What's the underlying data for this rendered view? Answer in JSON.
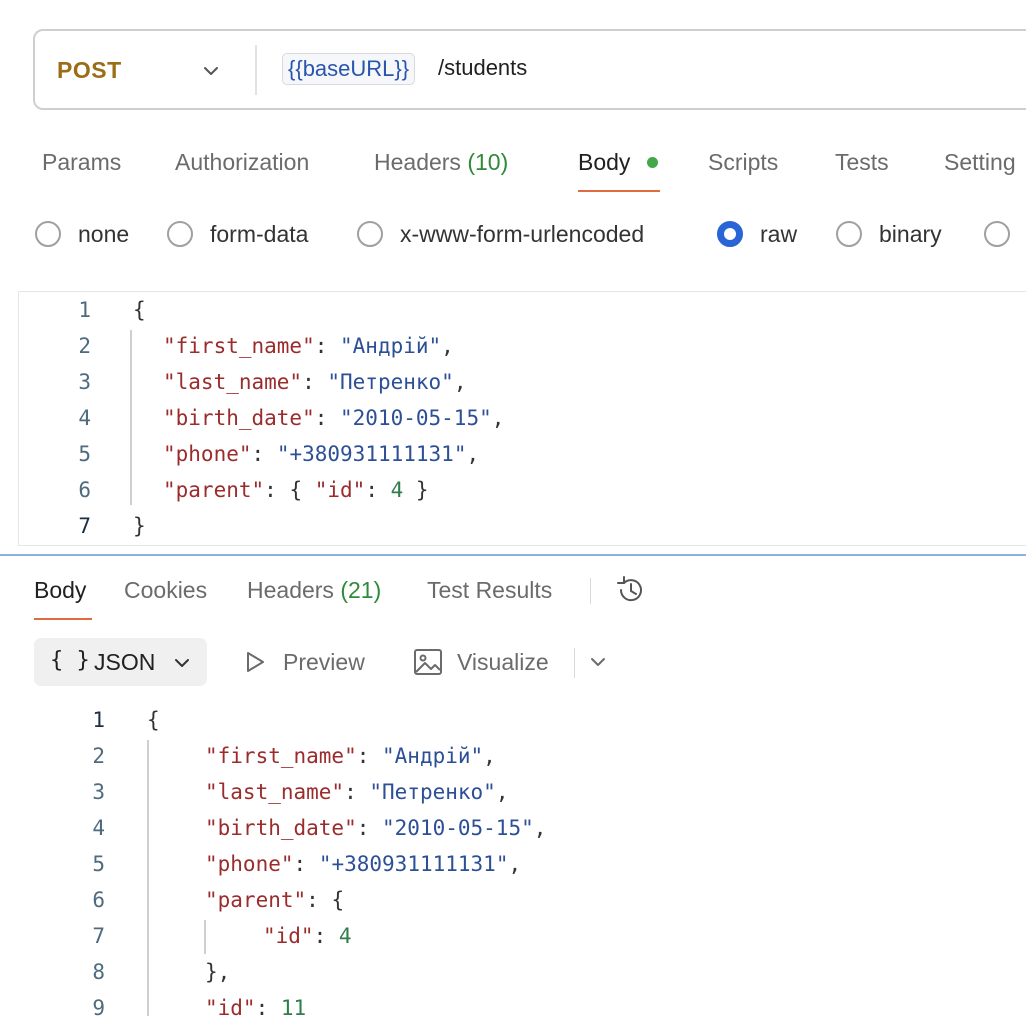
{
  "request": {
    "method": "POST",
    "url_variable": "{{baseURL}}",
    "url_path": "/students"
  },
  "request_tabs": [
    {
      "label": "Params"
    },
    {
      "label": "Authorization"
    },
    {
      "label": "Headers",
      "count": "(10)"
    },
    {
      "label": "Body",
      "active": true
    },
    {
      "label": "Scripts"
    },
    {
      "label": "Tests"
    },
    {
      "label": "Setting"
    }
  ],
  "body_types": [
    {
      "label": "none",
      "selected": false
    },
    {
      "label": "form-data",
      "selected": false
    },
    {
      "label": "x-www-form-urlencoded",
      "selected": false
    },
    {
      "label": "raw",
      "selected": true
    },
    {
      "label": "binary",
      "selected": false
    }
  ],
  "request_body": {
    "line_numbers": [
      "1",
      "2",
      "3",
      "4",
      "5",
      "6",
      "7"
    ],
    "keys": {
      "first_name": "\"first_name\"",
      "last_name": "\"last_name\"",
      "birth_date": "\"birth_date\"",
      "phone": "\"phone\"",
      "parent": "\"parent\"",
      "id": "\"id\""
    },
    "values": {
      "first_name": "\"Андрій\"",
      "last_name": "\"Петренко\"",
      "birth_date": "\"2010-05-15\"",
      "phone": "\"+380931111131\"",
      "parent_id": "4"
    }
  },
  "response_tabs": [
    {
      "label": "Body",
      "active": true
    },
    {
      "label": "Cookies"
    },
    {
      "label": "Headers",
      "count": "(21)"
    },
    {
      "label": "Test Results"
    }
  ],
  "response_toolbar": {
    "format_icon": "{ }",
    "format": "JSON",
    "preview": "Preview",
    "visualize": "Visualize"
  },
  "response_body": {
    "line_numbers": [
      "1",
      "2",
      "3",
      "4",
      "5",
      "6",
      "7",
      "8",
      "9"
    ],
    "keys": {
      "first_name": "\"first_name\"",
      "last_name": "\"last_name\"",
      "birth_date": "\"birth_date\"",
      "phone": "\"phone\"",
      "parent": "\"parent\"",
      "id": "\"id\""
    },
    "values": {
      "first_name": "\"Андрій\"",
      "last_name": "\"Петренко\"",
      "birth_date": "\"2010-05-15\"",
      "phone": "\"+380931111131\"",
      "parent_id": "4",
      "id": "11"
    }
  },
  "colors": {
    "method": "#9a6d16",
    "accent_underline": "#e06b3d",
    "status_dot": "#42a84a",
    "radio_selected": "#2a65d6",
    "json_key": "#9b2c2c",
    "json_string": "#2c4f96",
    "json_number": "#2f7d4a"
  },
  "icons": [
    "chevron-down-icon",
    "history-icon",
    "play-icon",
    "image-icon"
  ]
}
